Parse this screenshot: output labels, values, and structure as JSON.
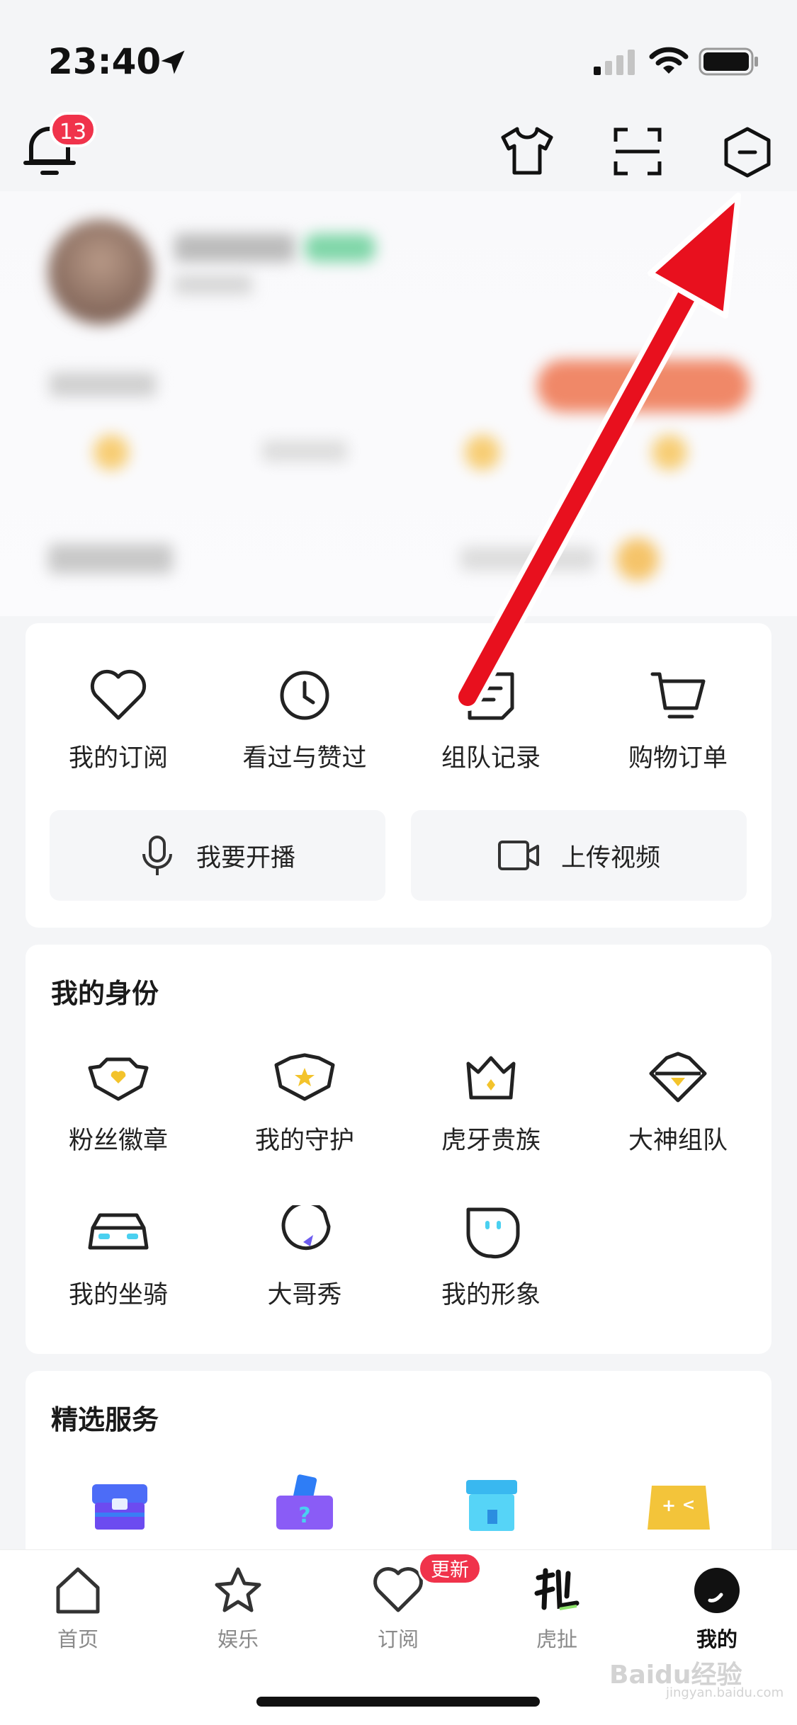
{
  "status_bar": {
    "time": "23:40"
  },
  "top_bar": {
    "notification_count": "13"
  },
  "quick_actions": [
    {
      "label": "我的订阅",
      "icon": "heart-icon"
    },
    {
      "label": "看过与赞过",
      "icon": "clock-icon"
    },
    {
      "label": "组队记录",
      "icon": "note-icon"
    },
    {
      "label": "购物订单",
      "icon": "cart-icon"
    }
  ],
  "buttons": {
    "broadcast": "我要开播",
    "upload": "上传视频"
  },
  "identity": {
    "title": "我的身份",
    "items": [
      {
        "label": "粉丝徽章",
        "icon": "fan-badge-icon"
      },
      {
        "label": "我的守护",
        "icon": "guard-icon"
      },
      {
        "label": "虎牙贵族",
        "icon": "crown-icon"
      },
      {
        "label": "大神组队",
        "icon": "diamond-icon"
      },
      {
        "label": "我的坐骑",
        "icon": "car-icon"
      },
      {
        "label": "大哥秀",
        "icon": "bubble-icon"
      },
      {
        "label": "我的形象",
        "icon": "face-icon"
      }
    ]
  },
  "services": {
    "title": "精选服务"
  },
  "tabbar": {
    "items": [
      {
        "label": "首页",
        "icon": "home-icon"
      },
      {
        "label": "娱乐",
        "icon": "star-icon"
      },
      {
        "label": "订阅",
        "icon": "heart-icon"
      },
      {
        "label": "虎扯",
        "icon": "huche-icon"
      },
      {
        "label": "我的",
        "icon": "profile-icon"
      }
    ],
    "update_badge": "更新"
  },
  "watermark": {
    "main": "Baidu经验",
    "sub": "jingyan.baidu.com"
  },
  "colors": {
    "accent_red": "#f0334b",
    "arrow_red": "#e8101e"
  }
}
